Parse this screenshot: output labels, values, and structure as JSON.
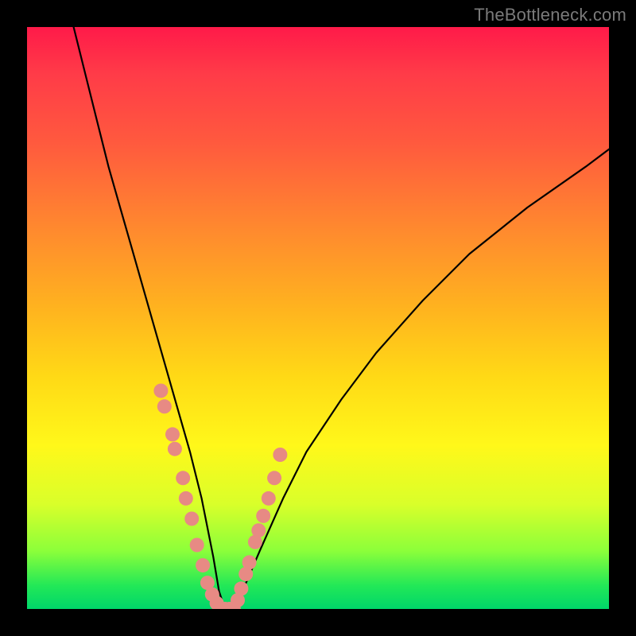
{
  "watermark": "TheBottleneck.com",
  "chart_data": {
    "type": "line",
    "title": "",
    "xlabel": "",
    "ylabel": "",
    "xlim": [
      0,
      100
    ],
    "ylim": [
      0,
      100
    ],
    "grid": false,
    "legend": false,
    "curve": {
      "name": "bottleneck-curve",
      "x": [
        8,
        10,
        12,
        14,
        16,
        18,
        20,
        22,
        24,
        26,
        28,
        30,
        32,
        33,
        34,
        35,
        37,
        40,
        44,
        48,
        54,
        60,
        68,
        76,
        86,
        96,
        100
      ],
      "y": [
        100,
        92,
        84,
        76,
        69,
        62,
        55,
        48,
        41,
        34,
        27,
        19,
        9,
        3,
        0,
        0,
        3,
        10,
        19,
        27,
        36,
        44,
        53,
        61,
        69,
        76,
        79
      ]
    },
    "flat_bottom": {
      "x_start": 33,
      "x_end": 35,
      "y": 0
    },
    "markers_left": {
      "x": [
        23.0,
        23.6,
        25.0,
        25.4,
        26.8,
        27.3,
        28.3,
        29.2,
        30.2,
        31.0,
        31.8,
        32.6
      ],
      "y": [
        37.5,
        34.8,
        30.0,
        27.5,
        22.5,
        19.0,
        15.5,
        11.0,
        7.5,
        4.5,
        2.5,
        1.0
      ]
    },
    "markers_right": {
      "x": [
        36.2,
        36.8,
        37.6,
        38.2,
        39.2,
        39.8,
        40.6,
        41.5,
        42.5,
        43.5
      ],
      "y": [
        1.5,
        3.5,
        6.0,
        8.0,
        11.5,
        13.5,
        16.0,
        19.0,
        22.5,
        26.5
      ]
    },
    "markers_bottom": {
      "x": [
        33.2,
        34.0,
        34.8,
        35.5
      ],
      "y": [
        0,
        0,
        0,
        0
      ]
    },
    "colors": {
      "curve_stroke": "#000000",
      "marker_fill": "#e78a84",
      "gradient_top": "#ff1a49",
      "gradient_mid": "#fff81a",
      "gradient_bottom": "#00d66a"
    }
  }
}
